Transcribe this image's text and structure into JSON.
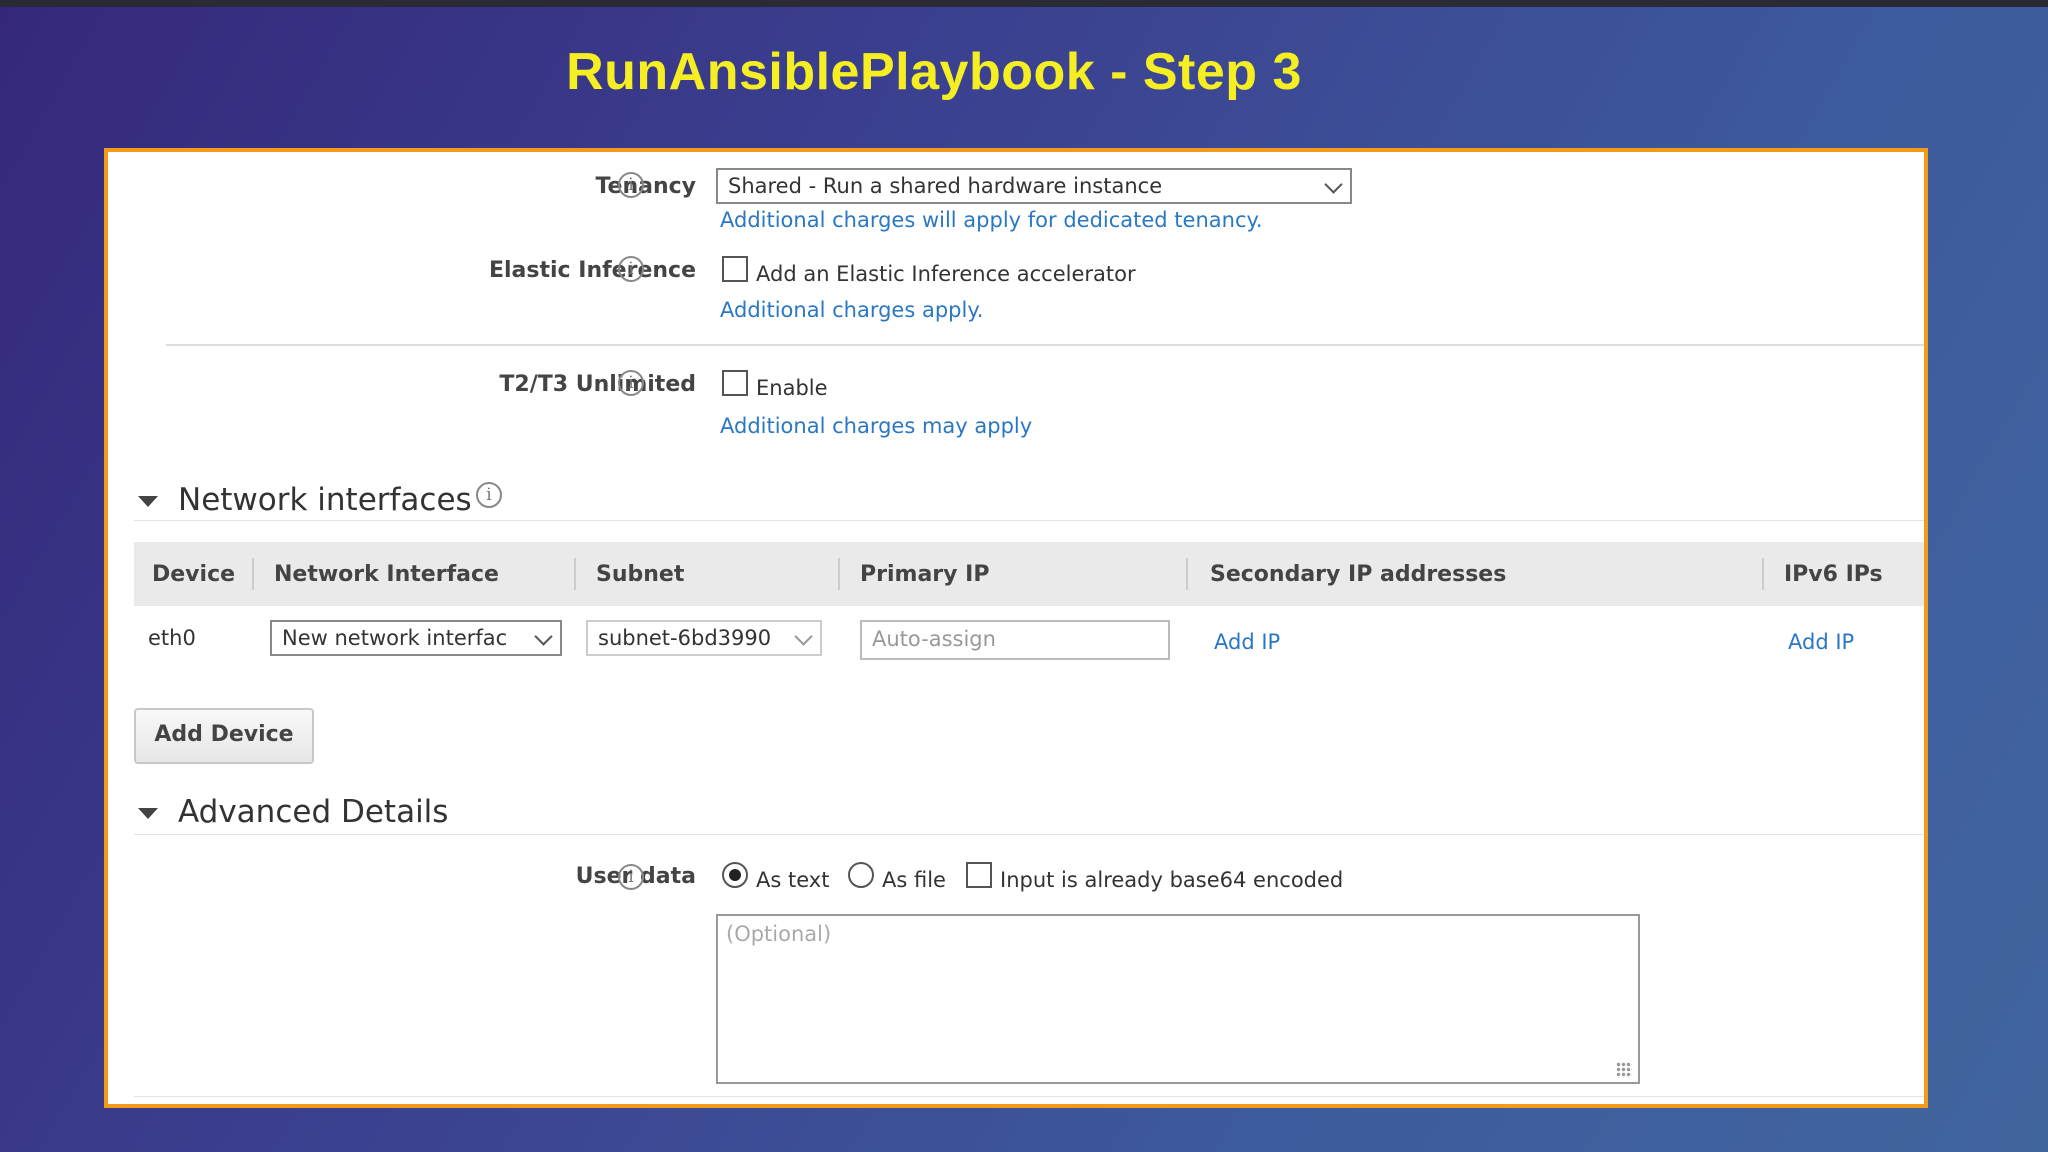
{
  "title": "RunAnsiblePlaybook - Step 3",
  "tenancy": {
    "label": "Tenancy",
    "selected": "Shared - Run a shared hardware instance",
    "note": "Additional charges will apply for dedicated tenancy."
  },
  "elastic_inference": {
    "label": "Elastic Inference",
    "checkbox_label": "Add an Elastic Inference accelerator",
    "checked": false,
    "note": "Additional charges apply."
  },
  "t2t3": {
    "label": "T2/T3 Unlimited",
    "checkbox_label": "Enable",
    "checked": false,
    "note": "Additional charges may apply"
  },
  "network": {
    "section_title": "Network interfaces",
    "columns": [
      "Device",
      "Network Interface",
      "Subnet",
      "Primary IP",
      "Secondary IP addresses",
      "IPv6 IPs"
    ],
    "rows": [
      {
        "device": "eth0",
        "interface": "New network interfac",
        "subnet": "subnet-6bd3990",
        "primary_ip_placeholder": "Auto-assign",
        "secondary_action": "Add IP",
        "ipv6_action": "Add IP"
      }
    ],
    "add_device": "Add Device"
  },
  "advanced": {
    "section_title": "Advanced Details",
    "user_data_label": "User data",
    "option_text": "As text",
    "option_file": "As file",
    "selected_option": "As text",
    "base64_label": "Input is already base64 encoded",
    "base64_checked": false,
    "textarea_placeholder": "(Optional)"
  },
  "colors": {
    "title": "#f5ee22",
    "panel_border": "#f39a1b",
    "link": "#2a78c4"
  },
  "icons": [
    "info-icon",
    "chevron-down-icon",
    "caret-down-icon",
    "resize-grip-icon"
  ]
}
